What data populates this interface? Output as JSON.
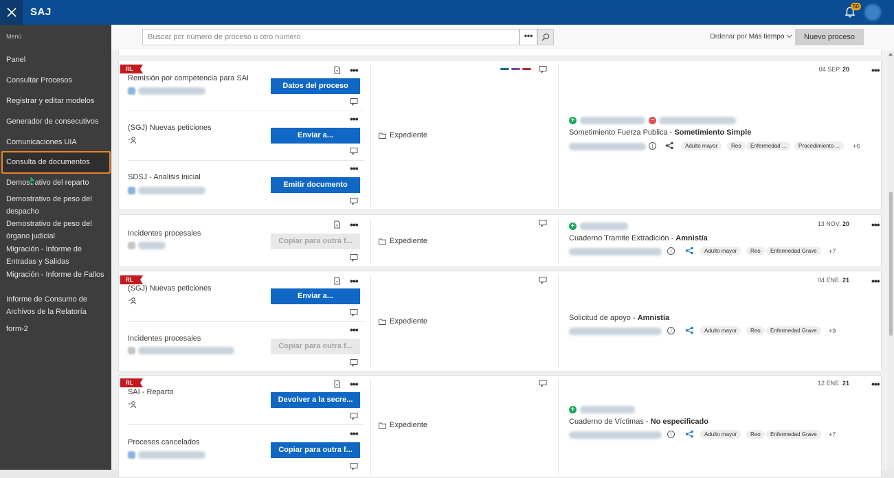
{
  "header": {
    "app_title": "SAJ",
    "notification_count": "50"
  },
  "sidebar": {
    "menu_label": "Menú",
    "items": [
      {
        "label": "Panel"
      },
      {
        "label": "Consultar Procesos"
      },
      {
        "label": "Registrar y editar modelos"
      },
      {
        "label": "Generador de consecutivos"
      },
      {
        "label": "Comunicaciones UIA"
      },
      {
        "label": "Consulta de documentos"
      },
      {
        "label": "Demostrativo del reparto"
      },
      {
        "label": "Demostrativo de peso del despacho"
      },
      {
        "label": "Demostrativo de peso del órgano judicial"
      },
      {
        "label": "Migración - Informe de Entradas y Salidas"
      },
      {
        "label": "Migración - Informe de Fallos"
      },
      {
        "label": "Informe de Consumo de Archivos de la Relatoría"
      },
      {
        "label": "form-2"
      }
    ]
  },
  "toolbar": {
    "search_placeholder": "Buscar por número de proceso u otro número",
    "more_label": "•••",
    "order_label": "Ordenar por",
    "order_value": "Más tiempo",
    "new_process_label": "Nuevo proceso"
  },
  "common": {
    "rl": "RL",
    "expediente": "Expediente",
    "dots": "•••"
  },
  "colors": {
    "accent": "#0a4d94",
    "primary_button": "#1067c4",
    "rl_badge": "#c3191f",
    "highlight": "#e8842c"
  },
  "cards": [
    {
      "has_rl": true,
      "date_prefix": "04 SEP.",
      "date_day": "20",
      "activities": [
        {
          "title": "Remisión por competencia para SAI",
          "button": "Datos del proceso",
          "enabled": true
        },
        {
          "title": "(SGJ) Nuevas peticiones",
          "button": "Enviar a...",
          "enabled": true
        },
        {
          "title": "SDSJ - Analisis inicial",
          "button": "Emitir documento",
          "enabled": true
        }
      ],
      "case_name": "Sometimiento Fuerza Publica",
      "case_type": "Sometimiento Simple",
      "tags": [
        "Adulto mayor",
        "Reo",
        "Enfermedad ...",
        "Procedimiento ..."
      ],
      "more_tags": "+6"
    },
    {
      "has_rl": false,
      "date_prefix": "13 NOV.",
      "date_day": "20",
      "activities": [
        {
          "title": "Incidentes procesales",
          "button": "Copiar para outra f...",
          "enabled": false
        }
      ],
      "case_name": "Cuaderno Tramite Extradición",
      "case_type": "Amnistía",
      "tags": [
        "Adulto mayor",
        "Reo",
        "Enfermedad Grave"
      ],
      "more_tags": "+7"
    },
    {
      "has_rl": true,
      "date_prefix": "04 ENE.",
      "date_day": "21",
      "activities": [
        {
          "title": "(SGJ) Nuevas peticiones",
          "button": "Enviar a...",
          "enabled": true
        },
        {
          "title": "Incidentes procesales",
          "button": "Copiar para outra f...",
          "enabled": false
        }
      ],
      "case_name": "Solicitud de apoyo",
      "case_type": "Amnistía",
      "tags": [
        "Adulto mayor",
        "Reo",
        "Enfermedad Grave"
      ],
      "more_tags": "+9"
    },
    {
      "has_rl": true,
      "date_prefix": "12 ENE.",
      "date_day": "21",
      "activities": [
        {
          "title": "SAI - Reparto",
          "button": "Devolver a la secre...",
          "enabled": true
        },
        {
          "title": "Procesos cancelados",
          "button": "Copiar para outra f...",
          "enabled": true
        }
      ],
      "case_name": "Cuaderno de Víctimas",
      "case_type": "No especificado",
      "tags": [
        "Adulto mayor",
        "Reo",
        "Enfermedad Grave"
      ],
      "more_tags": "+7"
    }
  ]
}
